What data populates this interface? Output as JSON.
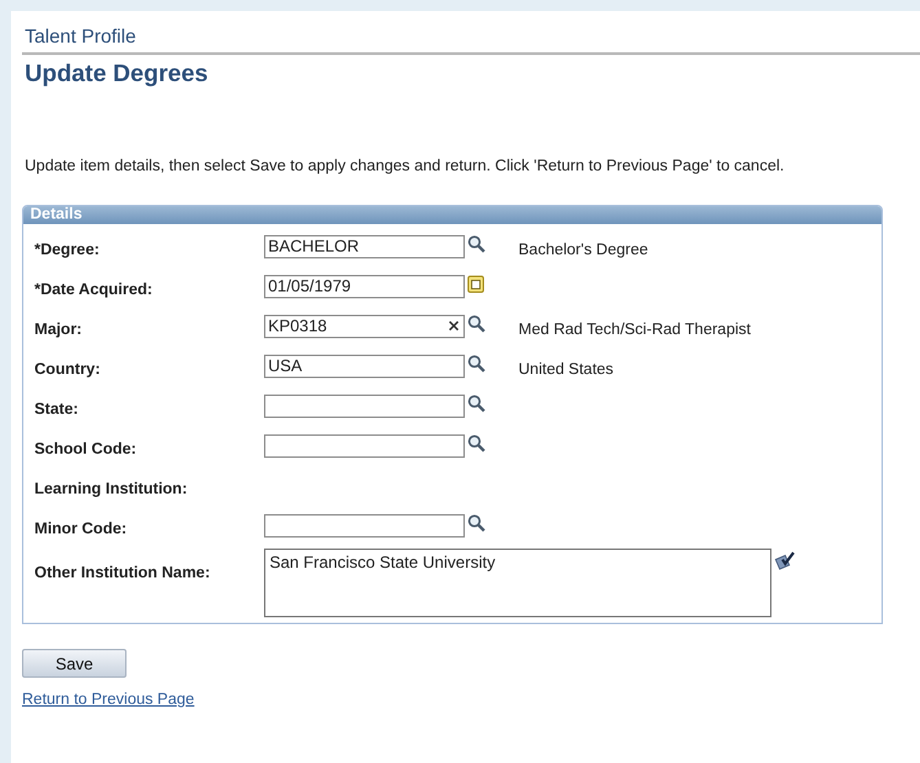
{
  "breadcrumb": "Talent Profile",
  "title": "Update Degrees",
  "instructions": "Update item details, then select Save to apply changes and return. Click 'Return to Previous Page' to cancel.",
  "details": {
    "heading": "Details",
    "fields": [
      {
        "kind": "lookup",
        "label": "*Degree:",
        "value": "BACHELOR",
        "description": "Bachelor's Degree",
        "clearable": false
      },
      {
        "kind": "date",
        "label": "*Date Acquired:",
        "value": "01/05/1979"
      },
      {
        "kind": "lookup",
        "label": "Major:",
        "value": "KP0318",
        "description": "Med Rad Tech/Sci-Rad Therapist",
        "clearable": true
      },
      {
        "kind": "lookup",
        "label": "Country:",
        "value": "USA",
        "description": "United States",
        "clearable": false
      },
      {
        "kind": "lookup",
        "label": "State:",
        "clearable": false
      },
      {
        "kind": "lookup",
        "label": "School Code:",
        "clearable": false
      },
      {
        "kind": "label",
        "label": "Learning Institution:"
      },
      {
        "kind": "lookup",
        "label": "Minor Code:",
        "clearable": false
      },
      {
        "kind": "textarea",
        "label": "Other Institution Name:",
        "value": "San Francisco State University"
      }
    ]
  },
  "save_button": "Save",
  "return_link": "Return to Previous Page"
}
